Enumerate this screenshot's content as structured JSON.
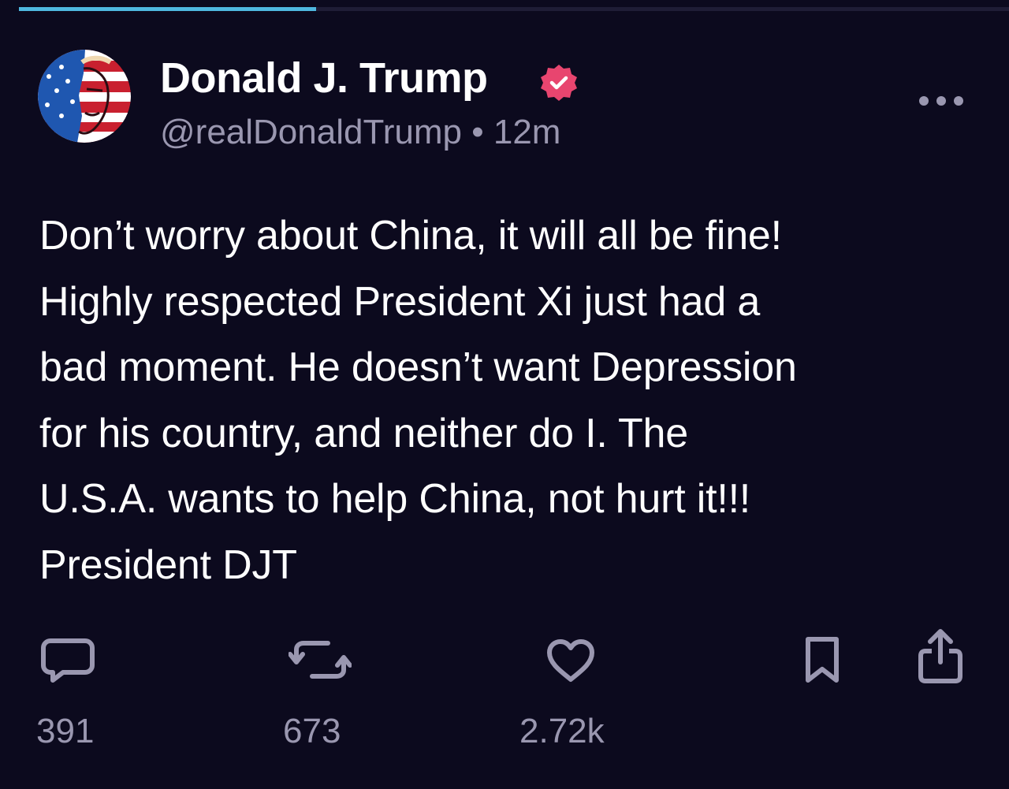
{
  "progress": {
    "fraction": 0.3
  },
  "post": {
    "author_name": "Donald J. Trump",
    "handle": "@realDonaldTrump",
    "separator": "•",
    "time": "12m",
    "text": "Don’t worry about China, it will all be fine!\nHighly respected President Xi just had a\nbad moment. He doesn’t want Depression\nfor his country, and neither do I. The\nU.S.A. wants to help China, not hurt it!!!\nPresident DJT"
  },
  "actions": {
    "replies": "391",
    "reposts": "673",
    "likes": "2.72k"
  },
  "icons": {
    "reply": "speech-bubble-icon",
    "repost": "repost-arrows-icon",
    "like": "heart-icon",
    "bookmark": "bookmark-icon",
    "share": "share-icon",
    "more": "ellipsis-icon",
    "verified": "verified-badge-icon"
  },
  "colors": {
    "background": "#0c0a1e",
    "text": "#ffffff",
    "muted": "#9a97b0",
    "verified": "#e8456f",
    "progress": "#4fb8e0"
  }
}
